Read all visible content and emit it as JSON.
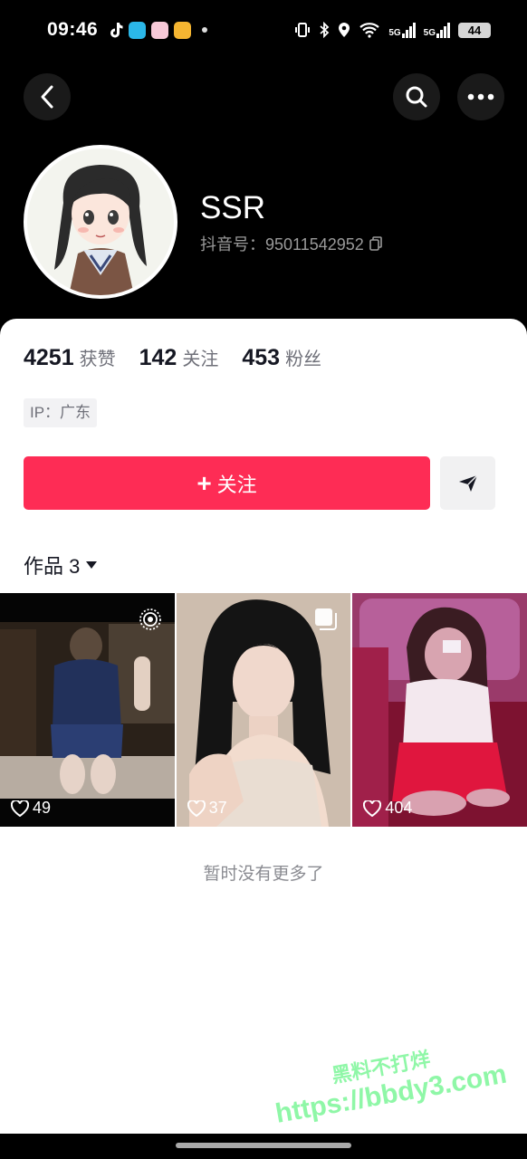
{
  "status_bar": {
    "time": "09:46",
    "battery": "44",
    "network_1": "5G",
    "network_2": "5G"
  },
  "profile": {
    "nickname": "SSR",
    "douyin_id_label": "抖音号：",
    "douyin_id": "95011542952"
  },
  "stats": [
    {
      "value": "4251",
      "label": "获赞"
    },
    {
      "value": "142",
      "label": "关注"
    },
    {
      "value": "453",
      "label": "粉丝"
    }
  ],
  "ip_tag": "IP：广东",
  "actions": {
    "follow_plus": "+",
    "follow_label": "关注"
  },
  "works_tab": {
    "label": "作品 3"
  },
  "videos": [
    {
      "likes": "49",
      "badge": "live-photo-icon"
    },
    {
      "likes": "37",
      "badge": "image-set-icon"
    },
    {
      "likes": "404",
      "badge": ""
    }
  ],
  "footer_text": "暂时没有更多了",
  "watermark": {
    "line1": "黑料不打烊",
    "line2": "https://bbdy3.com"
  },
  "colors": {
    "accent": "#fe2c55",
    "text_primary": "#161823",
    "text_secondary": "#6f7079",
    "header_bg": "#000000"
  }
}
